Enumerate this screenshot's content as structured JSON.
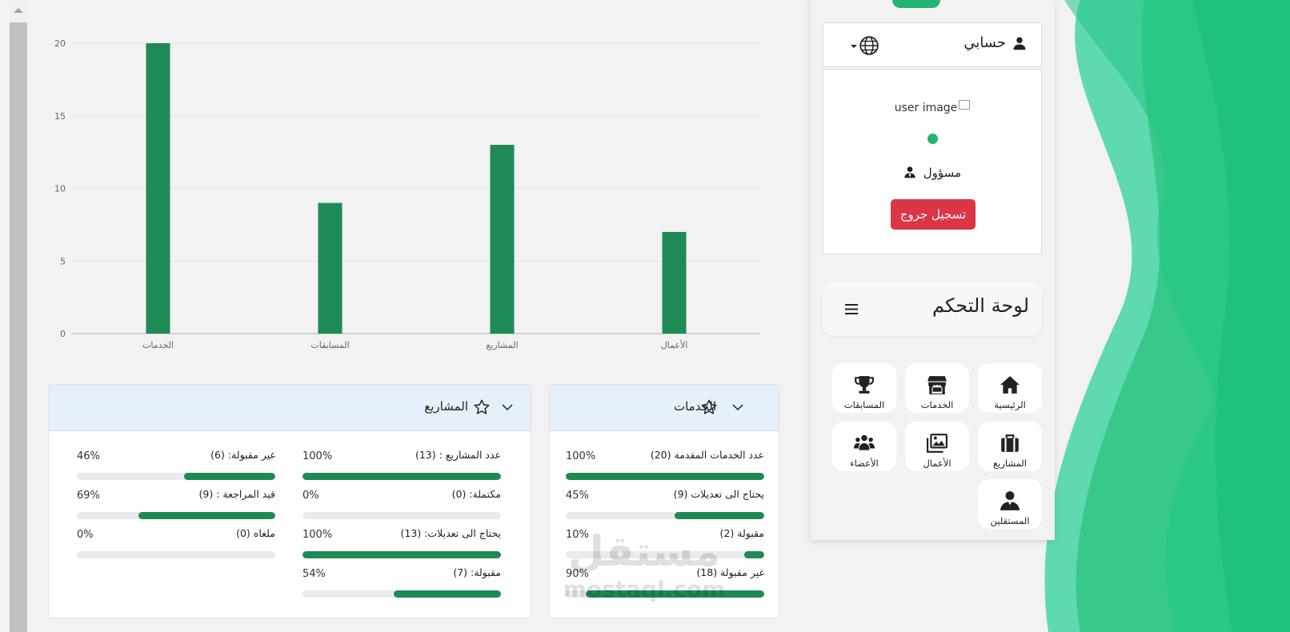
{
  "chart_data": {
    "type": "bar",
    "categories": [
      "الخدمات",
      "المسابقات",
      "المشاريع",
      "الأعمال"
    ],
    "values": [
      20,
      9,
      13,
      7
    ],
    "ylim": [
      0,
      20
    ],
    "yticks": [
      0,
      5,
      10,
      15,
      20
    ],
    "grid": true,
    "bar_color": "#1f8a55"
  },
  "services_card": {
    "title": "الخدمات",
    "stats": [
      {
        "label": "عدد الخدمات المقدمة (20)",
        "pct_text": "100%",
        "pct": 100
      },
      {
        "label": "يحتاج الى تعديلات (9)",
        "pct_text": "45%",
        "pct": 45
      },
      {
        "label": "مقبولة (2)",
        "pct_text": "10%",
        "pct": 10
      },
      {
        "label": "غير مقبولة (18)",
        "pct_text": "90%",
        "pct": 90
      }
    ]
  },
  "projects_card": {
    "title": "المشاريع",
    "stats_right": [
      {
        "label": "عدد المشاريع : (13)",
        "pct_text": "100%",
        "pct": 100
      },
      {
        "label": "مكتملة: (0)",
        "pct_text": "0%",
        "pct": 0
      },
      {
        "label": "يحتاج الى تعديلات: (13)",
        "pct_text": "100%",
        "pct": 100
      },
      {
        "label": "مقبولة: (7)",
        "pct_text": "54%",
        "pct": 54
      }
    ],
    "stats_left": [
      {
        "label": "غير مقبولة: (6)",
        "pct_text": "46%",
        "pct": 46
      },
      {
        "label": "قيد المراجعة : (9)",
        "pct_text": "69%",
        "pct": 69
      },
      {
        "label": "ملغاه (0)",
        "pct_text": "0%",
        "pct": 0
      }
    ]
  },
  "sidebar": {
    "account_label": "حسابي",
    "user_image_alt": "user image",
    "role": "مسؤول",
    "logout": "تسجيل جروج",
    "dashboard_title": "لوحة التحكم",
    "tiles": [
      {
        "label": "الرئيسية",
        "icon": "home-icon"
      },
      {
        "label": "الخدمات",
        "icon": "store-icon"
      },
      {
        "label": "المسابقات",
        "icon": "trophy-icon"
      },
      {
        "label": "المشاريع",
        "icon": "briefcase-icon"
      },
      {
        "label": "الأعمال",
        "icon": "images-icon"
      },
      {
        "label": "الأعضاء",
        "icon": "users-icon"
      },
      {
        "label": "المستقلين",
        "icon": "freelancer-icon"
      }
    ]
  },
  "watermark": {
    "arabic": "مستقل",
    "latin": "mostaql.com"
  },
  "colors": {
    "accent_green": "#1e8a54",
    "wave_green": "#22c584",
    "danger": "#dc3545",
    "card_head": "#e6f0fa"
  }
}
